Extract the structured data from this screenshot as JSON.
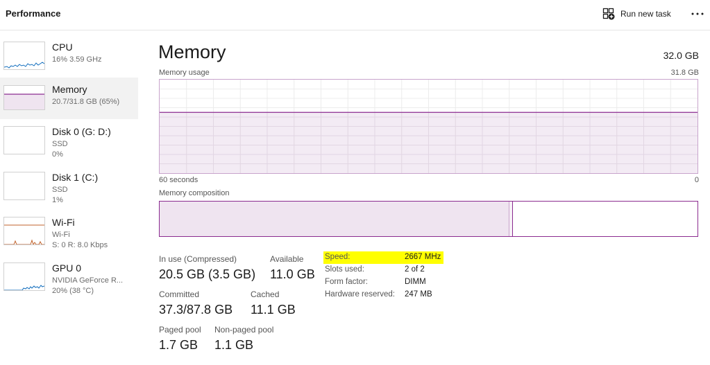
{
  "header": {
    "title": "Performance",
    "run_new_task_label": "Run new task"
  },
  "sidebar": {
    "items": [
      {
        "name": "CPU",
        "line1": "16%  3.59 GHz",
        "line2": "",
        "active": false,
        "color": "#0f6cbd"
      },
      {
        "name": "Memory",
        "line1": "20.7/31.8 GB (65%)",
        "line2": "",
        "active": true,
        "color": "#8a2a8f"
      },
      {
        "name": "Disk 0 (G: D:)",
        "line1": "SSD",
        "line2": "0%",
        "active": false,
        "color": "#4d8f2a"
      },
      {
        "name": "Disk 1 (C:)",
        "line1": "SSD",
        "line2": "1%",
        "active": false,
        "color": "#4d8f2a"
      },
      {
        "name": "Wi-Fi",
        "line1": "Wi-Fi",
        "line2": "S: 0 R: 8.0 Kbps",
        "active": false,
        "color": "#c0622b"
      },
      {
        "name": "GPU 0",
        "line1": "NVIDIA GeForce R...",
        "line2": "20% (38 °C)",
        "active": false,
        "color": "#0f6cbd"
      }
    ]
  },
  "main": {
    "title": "Memory",
    "total": "32.0 GB",
    "usage_label": "Memory usage",
    "usage_max": "31.8 GB",
    "usage_level_pct": 65,
    "time_label": "60 seconds",
    "time_zero": "0",
    "composition_label": "Memory composition",
    "composition": {
      "in_use_fraction": 0.65,
      "modified_fraction": 0.006
    },
    "stats": {
      "in_use_label": "In use (Compressed)",
      "in_use_value": "20.5 GB (3.5 GB)",
      "available_label": "Available",
      "available_value": "11.0 GB",
      "committed_label": "Committed",
      "committed_value": "37.3/87.8 GB",
      "cached_label": "Cached",
      "cached_value": "11.1 GB",
      "paged_label": "Paged pool",
      "paged_value": "1.7 GB",
      "nonpaged_label": "Non-paged pool",
      "nonpaged_value": "1.1 GB"
    },
    "hardware": [
      {
        "label": "Speed:",
        "value": "2667 MHz",
        "highlighted": true
      },
      {
        "label": "Slots used:",
        "value": "2 of 2",
        "highlighted": false
      },
      {
        "label": "Form factor:",
        "value": "DIMM",
        "highlighted": false
      },
      {
        "label": "Hardware reserved:",
        "value": "247 MB",
        "highlighted": false
      }
    ]
  },
  "colors": {
    "accent_memory": "#8a2a8f",
    "memory_fill": "#efe4f0",
    "highlight": "#ffff00"
  },
  "icons": {
    "run_task": "add-task-icon",
    "more": "more-horizontal-icon"
  }
}
